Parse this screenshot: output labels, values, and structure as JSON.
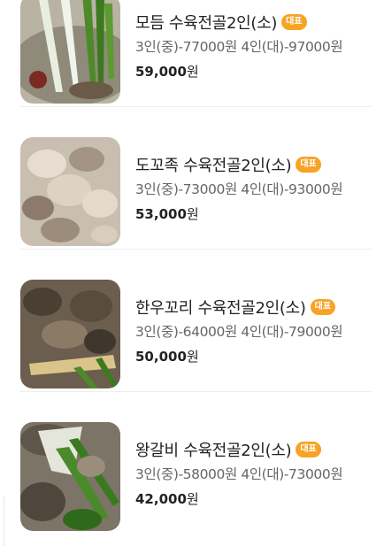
{
  "menu": {
    "items": [
      {
        "name": "모듬 수육전골2인(소)",
        "badge": "대표",
        "desc": "3인(중)-77000원 4인(대)-97000원",
        "price": "59,000",
        "unit": "원"
      },
      {
        "name": "도꼬족 수육전골2인(소)",
        "badge": "대표",
        "desc": "3인(중)-73000원 4인(대)-93000원",
        "price": "53,000",
        "unit": "원"
      },
      {
        "name": "한우꼬리 수육전골2인(소)",
        "badge": "대표",
        "desc": "3인(중)-64000원 4인(대)-79000원",
        "price": "50,000",
        "unit": "원"
      },
      {
        "name": "왕갈비 수육전골2인(소)",
        "badge": "대표",
        "desc": "3인(중)-58000원 4인(대)-73000원",
        "price": "42,000",
        "unit": "원"
      }
    ]
  },
  "colors": {
    "badge_bg": "#f7a325",
    "text_main": "#222222",
    "text_sub": "#666666",
    "divider": "#eeeeee"
  }
}
